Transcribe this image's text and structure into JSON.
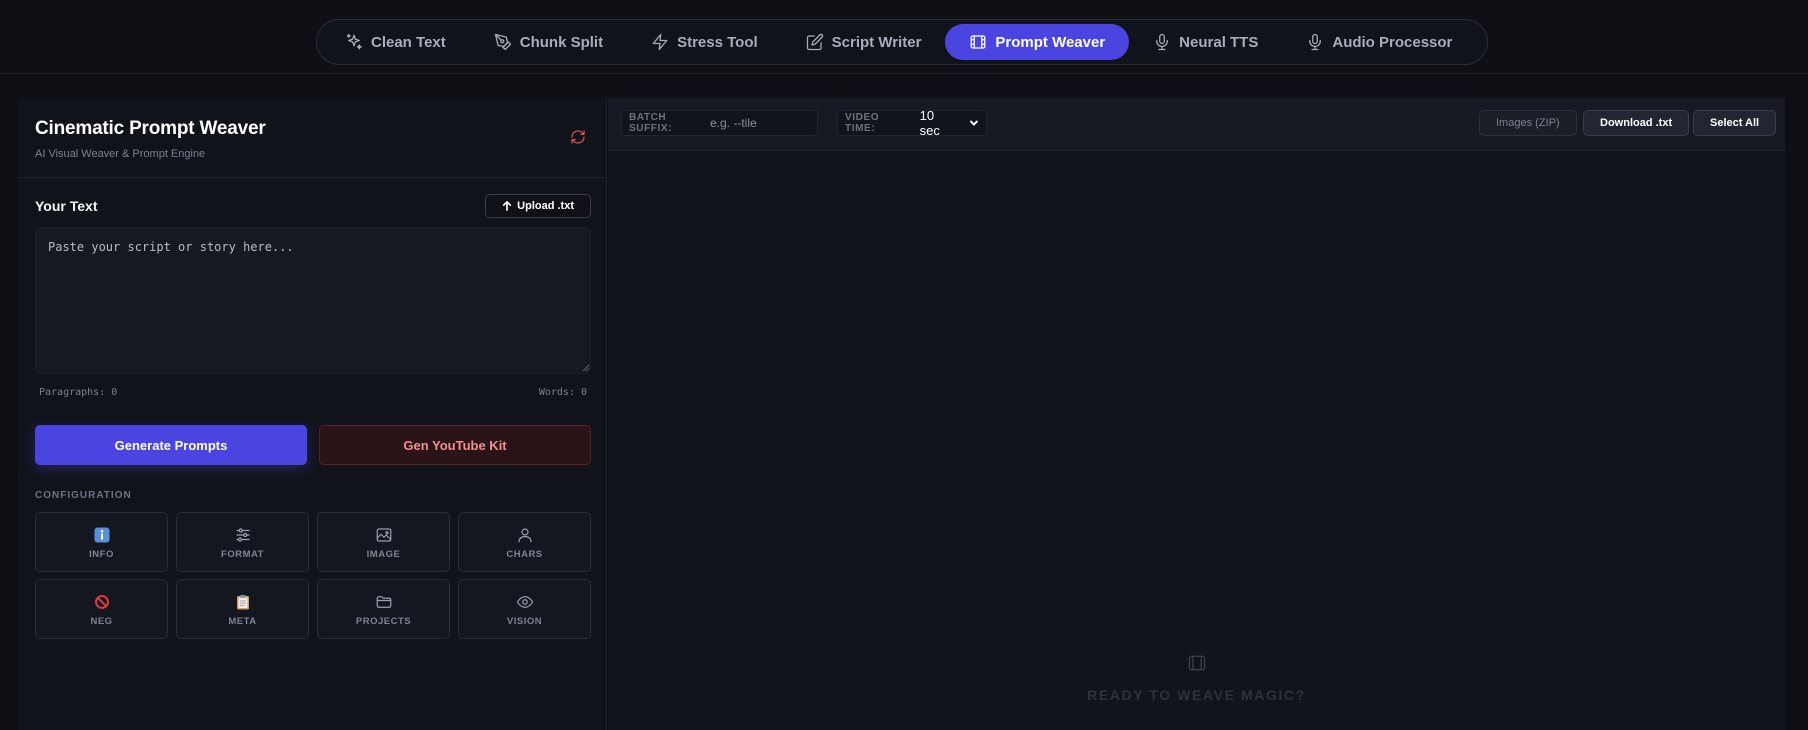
{
  "nav": {
    "items": [
      {
        "label": "Clean Text",
        "icon": "sparkles-icon",
        "active": false
      },
      {
        "label": "Chunk Split",
        "icon": "pen-nib-icon",
        "active": false
      },
      {
        "label": "Stress Tool",
        "icon": "lightning-icon",
        "active": false
      },
      {
        "label": "Script Writer",
        "icon": "edit-icon",
        "active": false
      },
      {
        "label": "Prompt Weaver",
        "icon": "film-icon",
        "active": true
      },
      {
        "label": "Neural TTS",
        "icon": "microphone-icon",
        "active": false
      },
      {
        "label": "Audio Processor",
        "icon": "microphone-icon",
        "active": false
      }
    ]
  },
  "panel": {
    "title": "Cinematic Prompt Weaver",
    "subtitle": "AI Visual Weaver & Prompt Engine"
  },
  "input": {
    "section_title": "Your Text",
    "upload_label": "Upload .txt",
    "placeholder": "Paste your script or story here...",
    "paragraphs_label": "Paragraphs: 0",
    "words_label": "Words: 0"
  },
  "actions": {
    "generate_label": "Generate Prompts",
    "youtube_label": "Gen YouTube Kit"
  },
  "config": {
    "label": "CONFIGURATION",
    "items": [
      {
        "label": "INFO",
        "icon": "info-icon"
      },
      {
        "label": "FORMAT",
        "icon": "sliders-icon"
      },
      {
        "label": "IMAGE",
        "icon": "image-icon"
      },
      {
        "label": "CHARS",
        "icon": "user-icon"
      },
      {
        "label": "NEG",
        "icon": "prohibited-icon"
      },
      {
        "label": "META",
        "icon": "clipboard-icon"
      },
      {
        "label": "PROJECTS",
        "icon": "folder-icon"
      },
      {
        "label": "VISION",
        "icon": "eye-icon"
      }
    ]
  },
  "toolbar": {
    "batch_suffix_label": "BATCH SUFFIX:",
    "batch_suffix_placeholder": "e.g. --tile",
    "video_time_label": "VIDEO TIME:",
    "video_time_value": "10 sec",
    "images_zip_label": "Images (ZIP)",
    "download_label": "Download .txt",
    "select_all_label": "Select All"
  },
  "empty_state": {
    "text": "READY TO WEAVE MAGIC?"
  },
  "colors": {
    "accent": "#4a45e0",
    "danger": "#e2574c",
    "youtube_text": "#f08f8f"
  }
}
